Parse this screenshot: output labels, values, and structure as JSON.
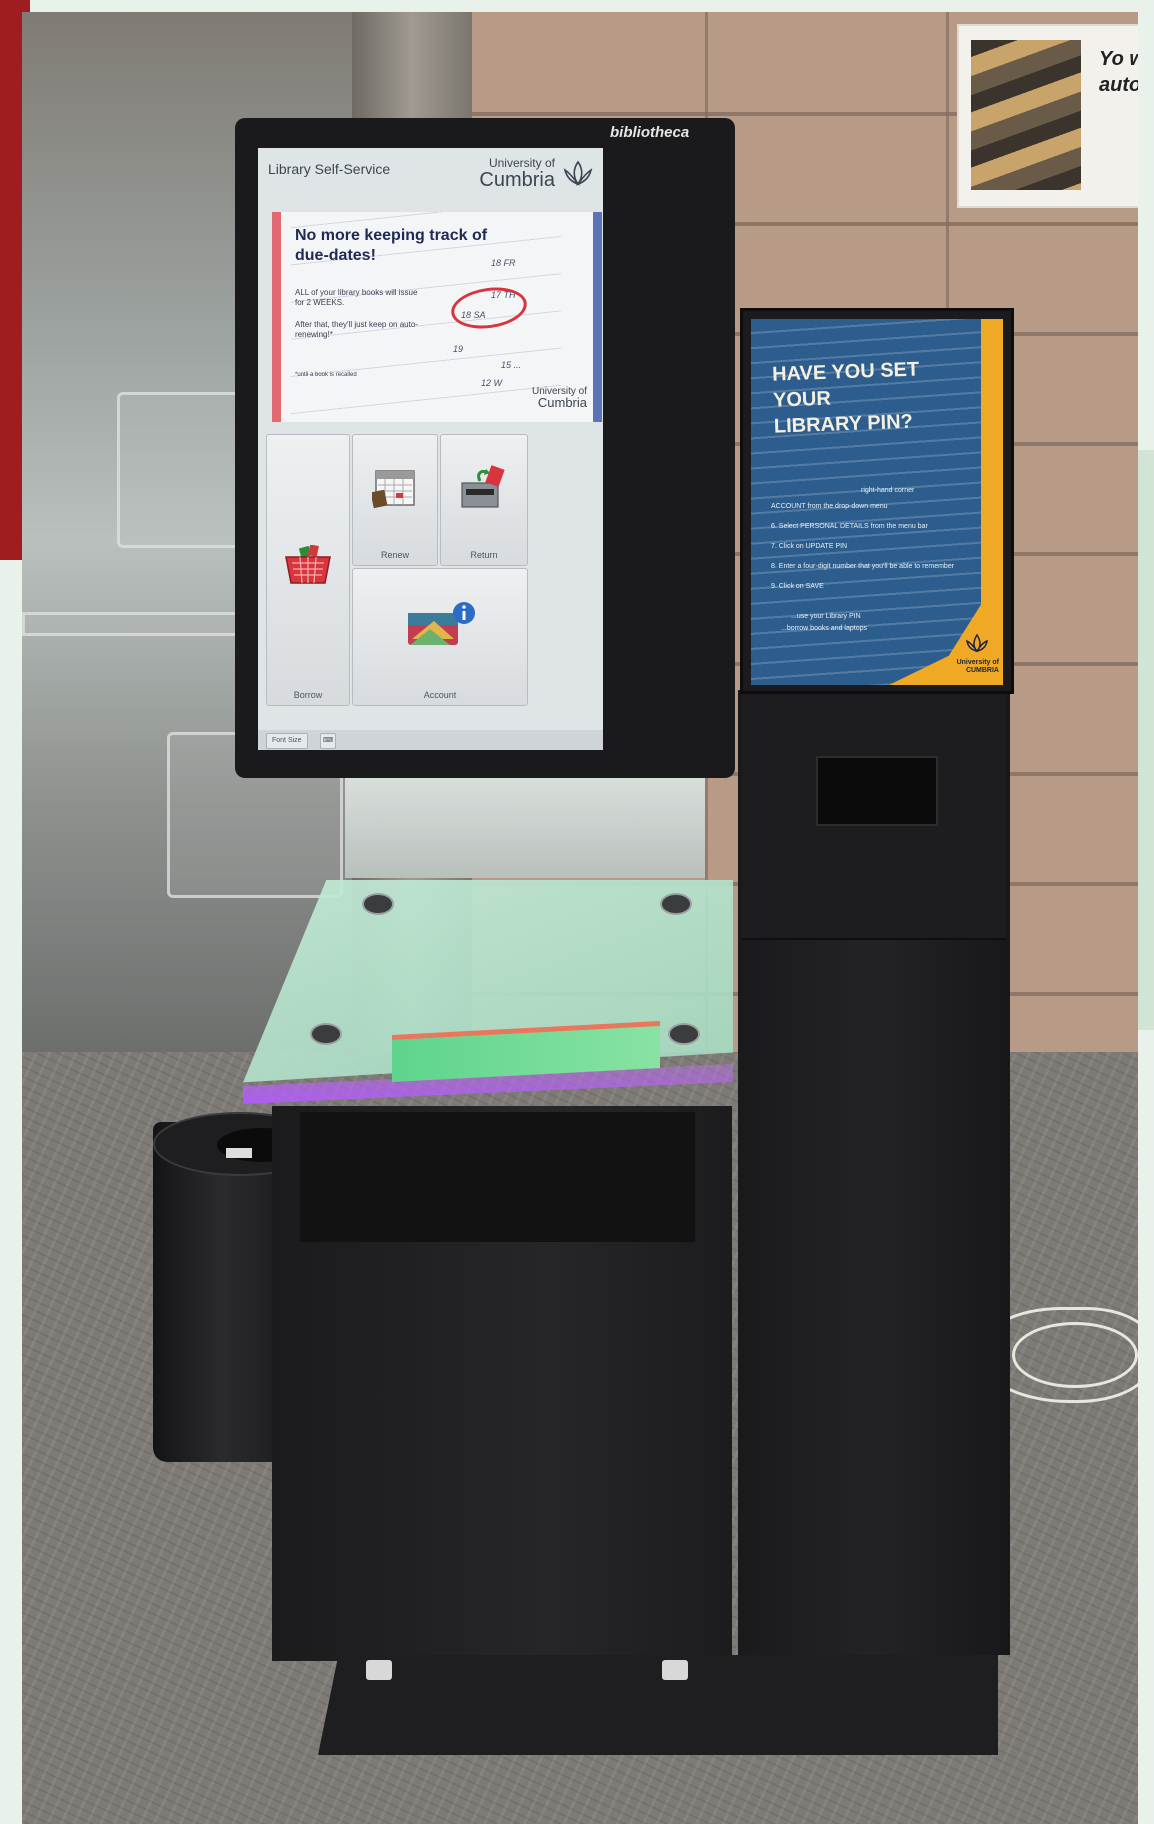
{
  "kiosk": {
    "brand": "bibliotheca",
    "screen": {
      "title": "Library Self-Service",
      "logo": {
        "small": "University of",
        "big": "Cumbria"
      },
      "banner": {
        "headline": "No more keeping track of due-dates!",
        "line1": "ALL of your library books will issue for 2 WEEKS.",
        "line2": "After that, they'll just keep on auto-renewing!*",
        "footnote": "*until a book is recalled",
        "dates": [
          "18 FR",
          "17 TH",
          "18 SA",
          "19",
          "15 ...",
          "12 W"
        ],
        "logo_small": "University of",
        "logo_big": "Cumbria"
      },
      "tiles": {
        "borrow": "Borrow",
        "renew": "Renew",
        "return": "Return",
        "account": "Account"
      },
      "bottom_bar": {
        "font_size": "Font Size"
      }
    }
  },
  "pin_poster": {
    "headline": "HAVE YOU SET YOUR LIBRARY PIN?",
    "steps": [
      "right-hand corner",
      "ACCOUNT from the drop-down menu",
      "6. Select PERSONAL DETAILS from the menu bar",
      "7. Click on UPDATE PIN",
      "8. Enter a four-digit number that you'll be able to remember",
      "9. Click on SAVE",
      "...use your Library PIN",
      "...borrow books and laptops"
    ],
    "logo": "University of CUMBRIA"
  },
  "poster_top": {
    "text": "Yo w auto"
  },
  "colors": {
    "kiosk_black": "#1e1e20",
    "led_purple": "#b052ff",
    "poster_blue": "#2c5d8d",
    "poster_orange": "#f0a925",
    "banner_navy": "#1f2a55",
    "circle_red": "#d8343e"
  }
}
